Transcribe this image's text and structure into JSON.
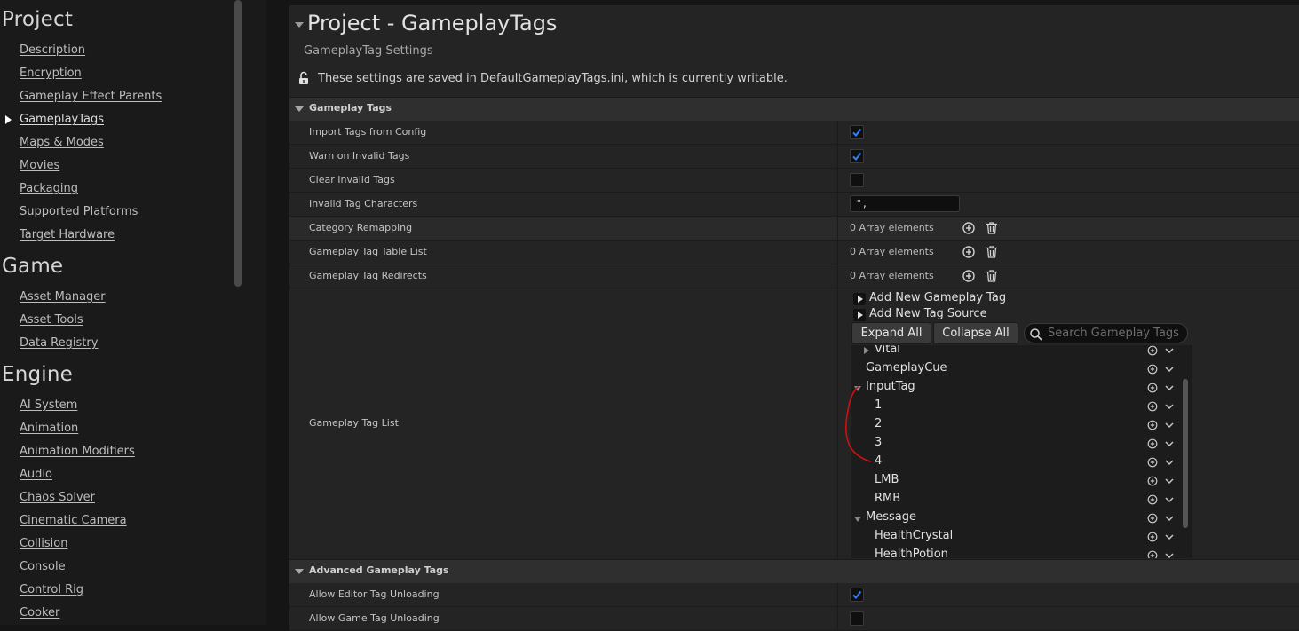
{
  "sidebar": {
    "sections": [
      {
        "title": "Project",
        "items": [
          "Description",
          "Encryption",
          "Gameplay Effect Parents",
          "GameplayTags",
          "Maps & Modes",
          "Movies",
          "Packaging",
          "Supported Platforms",
          "Target Hardware"
        ]
      },
      {
        "title": "Game",
        "items": [
          "Asset Manager",
          "Asset Tools",
          "Data Registry"
        ]
      },
      {
        "title": "Engine",
        "items": [
          "AI System",
          "Animation",
          "Animation Modifiers",
          "Audio",
          "Chaos Solver",
          "Cinematic Camera",
          "Collision",
          "Console",
          "Control Rig",
          "Cooker"
        ]
      }
    ],
    "active_item": "GameplayTags"
  },
  "header": {
    "title": "Project - GameplayTags",
    "subtitle": "GameplayTag Settings",
    "writable_note": "These settings are saved in DefaultGameplayTags.ini, which is currently writable.",
    "lock_icon": "unlocked-padlock-icon"
  },
  "gameplay_tags": {
    "category_label": "Gameplay Tags",
    "import_tags_label": "Import Tags from Config",
    "import_tags_checked": true,
    "warn_invalid_label": "Warn on Invalid Tags",
    "warn_invalid_checked": true,
    "clear_invalid_label": "Clear Invalid Tags",
    "clear_invalid_checked": false,
    "invalid_chars_label": "Invalid Tag Characters",
    "invalid_chars_value": "\",",
    "category_remapping_label": "Category Remapping",
    "category_remapping_count": "0 Array elements",
    "table_list_label": "Gameplay Tag Table List",
    "table_list_count": "0 Array elements",
    "redirects_label": "Gameplay Tag Redirects",
    "redirects_count": "0 Array elements",
    "tag_list_label": "Gameplay Tag List",
    "add_tag_label": "Add New Gameplay Tag",
    "add_source_label": "Add New Tag Source",
    "expand_all_label": "Expand All",
    "collapse_all_label": "Collapse All",
    "search_placeholder": "Search Gameplay Tags",
    "tree": [
      {
        "label": "Vital",
        "indent": 1,
        "state": "collapsed"
      },
      {
        "label": "GameplayCue",
        "indent": 0,
        "state": "leaf"
      },
      {
        "label": "InputTag",
        "indent": 0,
        "state": "expanded"
      },
      {
        "label": "1",
        "indent": 1,
        "state": "leaf"
      },
      {
        "label": "2",
        "indent": 1,
        "state": "leaf"
      },
      {
        "label": "3",
        "indent": 1,
        "state": "leaf"
      },
      {
        "label": "4",
        "indent": 1,
        "state": "leaf"
      },
      {
        "label": "LMB",
        "indent": 1,
        "state": "leaf"
      },
      {
        "label": "RMB",
        "indent": 1,
        "state": "leaf"
      },
      {
        "label": "Message",
        "indent": 0,
        "state": "expanded"
      },
      {
        "label": "HealthCrystal",
        "indent": 1,
        "state": "leaf"
      },
      {
        "label": "HealthPotion",
        "indent": 1,
        "state": "leaf"
      }
    ]
  },
  "advanced": {
    "category_label": "Advanced Gameplay Tags",
    "allow_editor_unloading_label": "Allow Editor Tag Unloading",
    "allow_editor_unloading_checked": true,
    "allow_game_unloading_label": "Allow Game Tag Unloading",
    "allow_game_unloading_checked": false
  },
  "colors": {
    "check_blue": "#2f7fff",
    "annotation_red": "#d01010"
  }
}
